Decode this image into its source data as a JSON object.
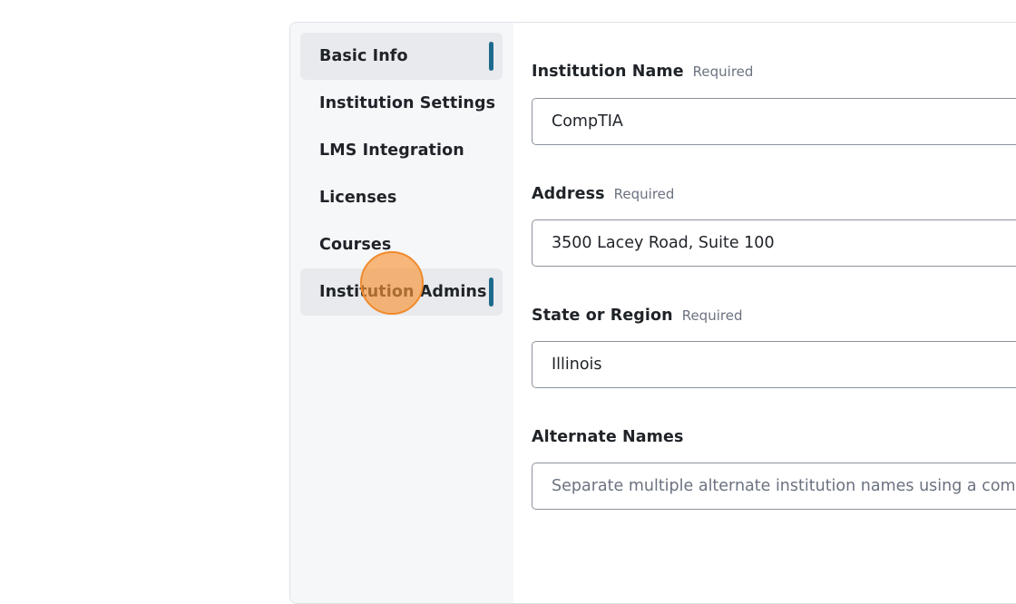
{
  "sidebar": {
    "items": [
      {
        "label": "Basic Info",
        "active": true
      },
      {
        "label": "Institution Settings",
        "active": false
      },
      {
        "label": "LMS Integration",
        "active": false
      },
      {
        "label": "Licenses",
        "active": false
      },
      {
        "label": "Courses",
        "active": false
      },
      {
        "label": "Institution Admins",
        "active": true
      }
    ]
  },
  "form": {
    "required_text": "Required",
    "institution_name": {
      "label": "Institution Name",
      "value": "CompTIA"
    },
    "address": {
      "label": "Address",
      "value": "3500 Lacey Road, Suite 100"
    },
    "state_region": {
      "label": "State or Region",
      "value": "Illinois"
    },
    "alternate_names": {
      "label": "Alternate Names",
      "value": "",
      "placeholder": "Separate multiple alternate institution names using a comma"
    }
  },
  "colors": {
    "accent": "#1e6a8c",
    "sidebar_bg": "#f6f7f9",
    "active_item_bg": "#e8eaed",
    "click_marker": "#f7943a"
  }
}
